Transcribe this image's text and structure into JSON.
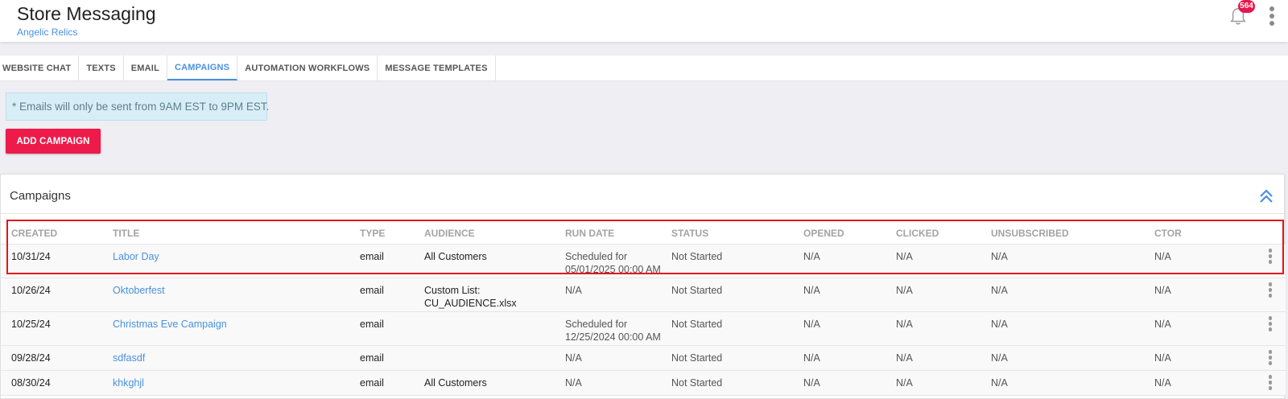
{
  "header": {
    "title": "Store Messaging",
    "store_name": "Angelic Relics",
    "notification_count": "564"
  },
  "tabs": [
    {
      "label": "WEBSITE CHAT",
      "active": false
    },
    {
      "label": "TEXTS",
      "active": false
    },
    {
      "label": "EMAIL",
      "active": false
    },
    {
      "label": "CAMPAIGNS",
      "active": true
    },
    {
      "label": "AUTOMATION WORKFLOWS",
      "active": false
    },
    {
      "label": "MESSAGE TEMPLATES",
      "active": false
    }
  ],
  "notice": "* Emails will only be sent from 9AM EST to 9PM EST.",
  "add_button_label": "ADD CAMPAIGN",
  "campaigns": {
    "title": "Campaigns",
    "columns": [
      "CREATED",
      "TITLE",
      "TYPE",
      "AUDIENCE",
      "RUN DATE",
      "STATUS",
      "OPENED",
      "CLICKED",
      "UNSUBSCRIBED",
      "CTOR"
    ],
    "rows": [
      {
        "created": "10/31/24",
        "title": "Labor Day",
        "type": "email",
        "audience": "All Customers",
        "run_date": "Scheduled for\n05/01/2025 00:00 AM",
        "status": "Not Started",
        "opened": "N/A",
        "clicked": "N/A",
        "unsubscribed": "N/A",
        "ctor": "N/A"
      },
      {
        "created": "10/26/24",
        "title": "Oktoberfest",
        "type": "email",
        "audience": "Custom List:\nCU_AUDIENCE.xlsx",
        "run_date": "N/A",
        "status": "Not Started",
        "opened": "N/A",
        "clicked": "N/A",
        "unsubscribed": "N/A",
        "ctor": "N/A"
      },
      {
        "created": "10/25/24",
        "title": "Christmas Eve Campaign",
        "type": "email",
        "audience": "",
        "run_date": "Scheduled for\n12/25/2024 00:00 AM",
        "status": "Not Started",
        "opened": "N/A",
        "clicked": "N/A",
        "unsubscribed": "N/A",
        "ctor": "N/A"
      },
      {
        "created": "09/28/24",
        "title": "sdfasdf",
        "type": "email",
        "audience": "",
        "run_date": "N/A",
        "status": "Not Started",
        "opened": "N/A",
        "clicked": "N/A",
        "unsubscribed": "N/A",
        "ctor": "N/A"
      },
      {
        "created": "08/30/24",
        "title": "khkghjl",
        "type": "email",
        "audience": "All Customers",
        "run_date": "N/A",
        "status": "Not Started",
        "opened": "N/A",
        "clicked": "N/A",
        "unsubscribed": "N/A",
        "ctor": "N/A"
      }
    ]
  },
  "colors": {
    "accent": "#4a90e2",
    "primary_button": "#ee1a4a",
    "highlight_border": "#e3141f",
    "notice_bg": "#d8eef6"
  }
}
